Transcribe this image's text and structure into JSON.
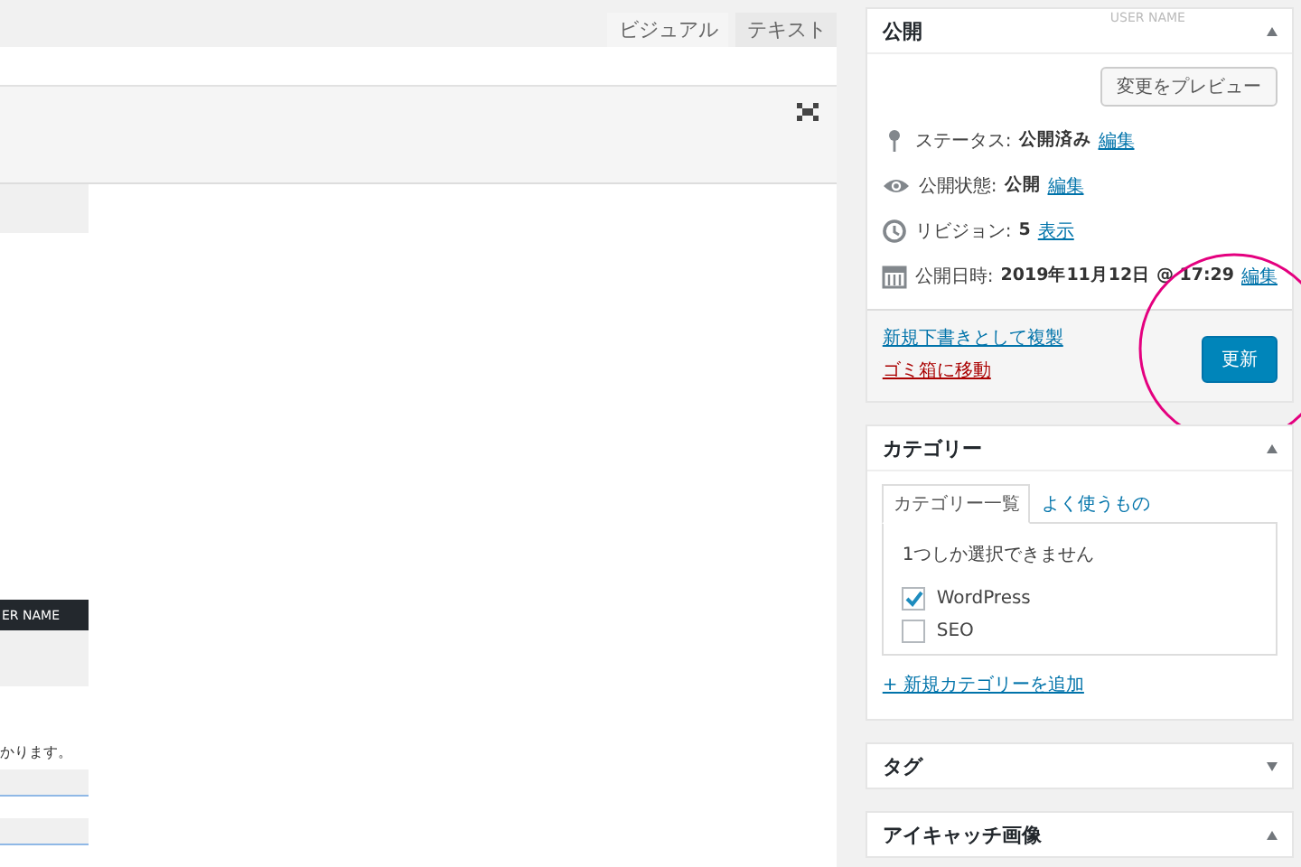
{
  "editor": {
    "tabs": [
      {
        "label": "ビジュアル",
        "selected": true
      },
      {
        "label": "テキスト",
        "selected": false
      }
    ],
    "embedded_image": {
      "header_text": "ER NAME",
      "text": "かります。"
    }
  },
  "publish": {
    "title": "公開",
    "expanded": true,
    "overlay_text": "USER NAME",
    "preview_button": "変更をプレビュー",
    "rows": [
      {
        "kind": "status",
        "label": "ステータス:",
        "value": "公開済み",
        "link": "編集"
      },
      {
        "kind": "visibility",
        "label": "公開状態:",
        "value": "公開",
        "link": "編集"
      },
      {
        "kind": "revisions",
        "label": "リビジョン:",
        "value": "5",
        "link": "表示"
      },
      {
        "kind": "date",
        "label": "公開日時:",
        "value": "2019年11月12日 @ 17:29",
        "link": "編集"
      }
    ],
    "duplicate_link": "新規下書きとして複製",
    "trash_link": "ゴミ箱に移動",
    "update_button": "更新"
  },
  "categories": {
    "title": "カテゴリー",
    "expanded": true,
    "tabs": [
      {
        "label": "カテゴリー一覧",
        "selected": true
      },
      {
        "label": "よく使うもの",
        "selected": false
      }
    ],
    "note": "1つしか選択できません",
    "items": [
      {
        "label": "WordPress",
        "checked": true
      },
      {
        "label": "SEO",
        "checked": false
      }
    ],
    "add_link": "+ 新規カテゴリーを追加"
  },
  "tags": {
    "title": "タグ",
    "expanded": false
  },
  "featured_image": {
    "title": "アイキャッチ画像",
    "expanded": true
  }
}
